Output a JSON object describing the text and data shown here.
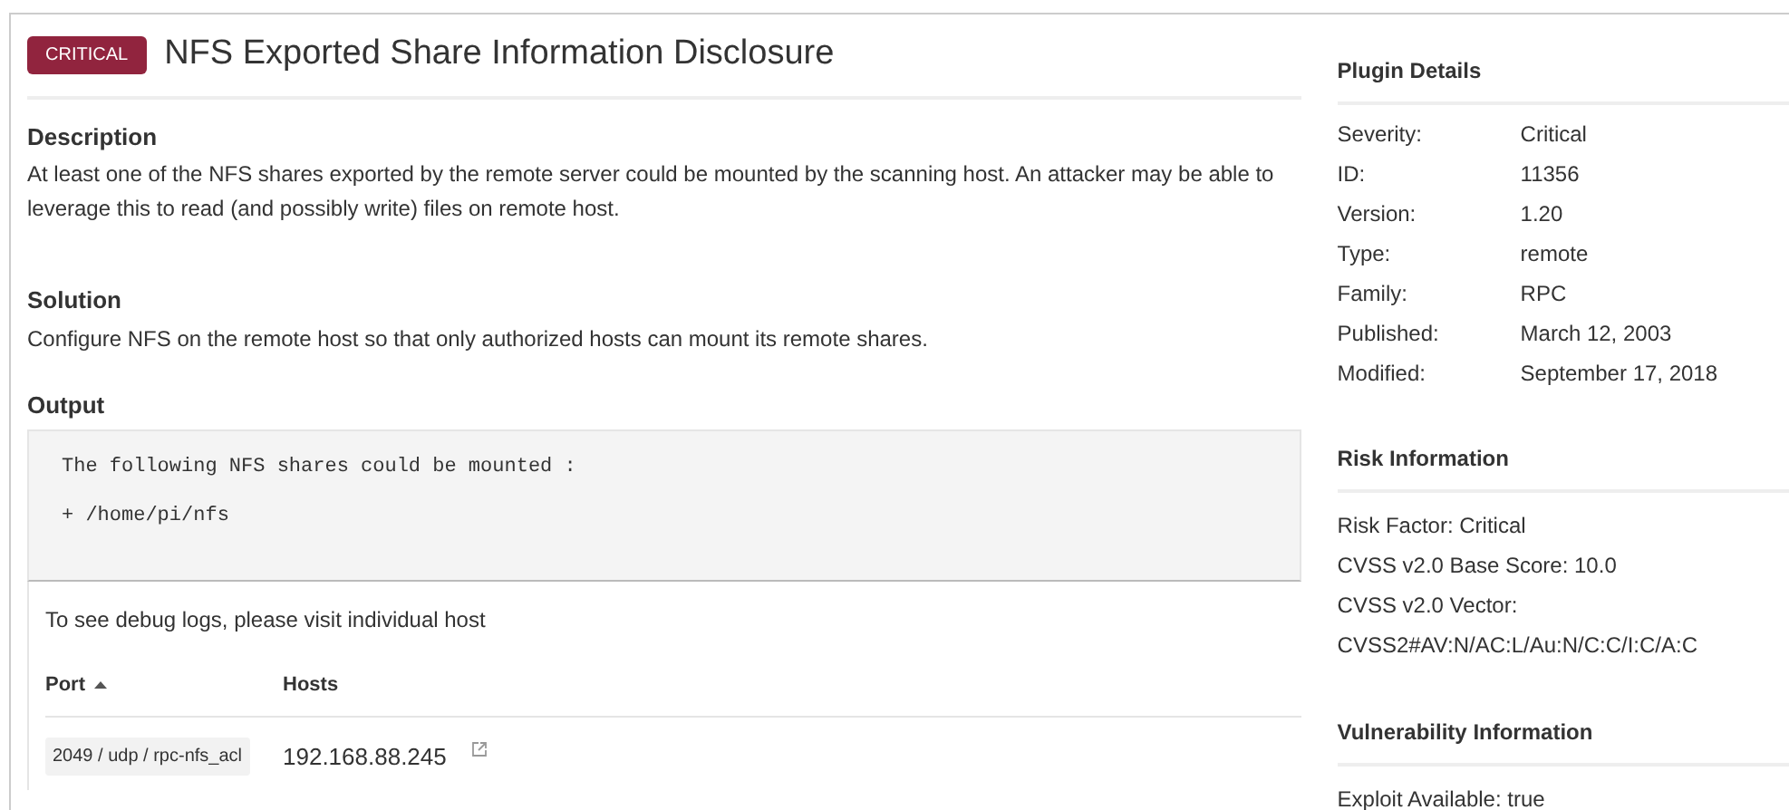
{
  "header": {
    "severity_badge": "CRITICAL",
    "title": "NFS Exported Share Information Disclosure"
  },
  "sections": [
    {
      "heading": "Description",
      "body": "At least one of the NFS shares exported by the remote server could be mounted by the scanning host. An attacker may be able to leverage this to read (and possibly write) files on remote host."
    },
    {
      "heading": "Solution",
      "body": "Configure NFS on the remote host so that only authorized hosts can mount its remote shares."
    }
  ],
  "output": {
    "heading": "Output",
    "lines": [
      "The following NFS shares could be mounted :",
      "+ /home/pi/nfs"
    ],
    "note": "To see debug logs, please visit individual host",
    "table": {
      "columns": [
        {
          "label": "Port",
          "sorted": true
        },
        {
          "label": "Hosts",
          "sorted": false
        }
      ],
      "rows": [
        {
          "port": "2049 / udp / rpc-nfs_acl",
          "host": "192.168.88.245"
        }
      ]
    }
  },
  "plugin_details": {
    "heading": "Plugin Details",
    "rows": [
      {
        "label": "Severity:",
        "value": "Critical"
      },
      {
        "label": "ID:",
        "value": "11356"
      },
      {
        "label": "Version:",
        "value": "1.20"
      },
      {
        "label": "Type:",
        "value": "remote"
      },
      {
        "label": "Family:",
        "value": "RPC"
      },
      {
        "label": "Published:",
        "value": "March 12, 2003"
      },
      {
        "label": "Modified:",
        "value": "September 17, 2018"
      }
    ]
  },
  "risk_information": {
    "heading": "Risk Information",
    "lines": [
      "Risk Factor: Critical",
      "CVSS v2.0 Base Score: 10.0",
      "CVSS v2.0 Vector:",
      "CVSS2#AV:N/AC:L/Au:N/C:C/I:C/A:C"
    ]
  },
  "vulnerability_information": {
    "heading": "Vulnerability Information",
    "lines": [
      "Exploit Available: true"
    ]
  }
}
